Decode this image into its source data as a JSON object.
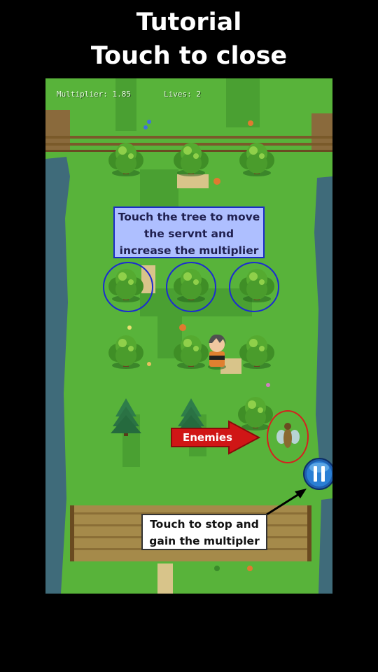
{
  "header": {
    "title_line1": "Tutorial",
    "title_line2": "Touch to close"
  },
  "hud": {
    "multiplier": "Multiplier: 1.85",
    "lives": "Lives: 2"
  },
  "hints": {
    "tree": [
      "Touch the tree to move",
      "the servnt and",
      "increase the multiplier"
    ],
    "enemies": "Enemies",
    "pause": [
      "Touch to stop and",
      "gain the multipler"
    ]
  },
  "colors": {
    "grass": "#58b33a",
    "hint_border": "#1a2cc8",
    "enemy_highlight": "#d6201e",
    "pause_button": "#2a7fd4"
  },
  "icons": {
    "pause": "pause-icon",
    "player": "servant-character",
    "enemy": "insect-enemy"
  }
}
